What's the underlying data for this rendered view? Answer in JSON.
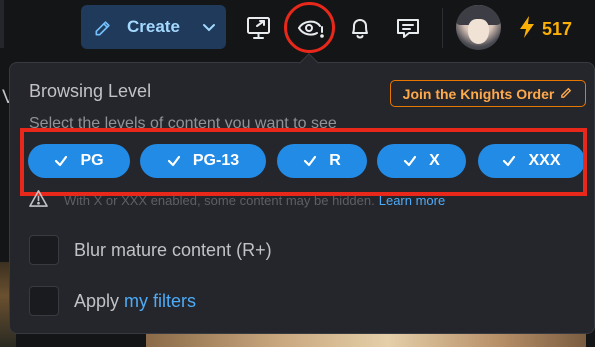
{
  "header": {
    "create_label": "Create",
    "icons": [
      "pencil-icon",
      "chevron-down-icon",
      "screen-share-icon",
      "eye-warning-icon",
      "bell-icon",
      "chat-icon"
    ],
    "buzz_count": "517",
    "accent": "#228be6",
    "highlight": "#e8281a"
  },
  "popover": {
    "title": "Browsing Level",
    "knights_button": "Join the Knights Order",
    "subtitle": "Select the levels of content you want to see",
    "levels": [
      {
        "label": "PG",
        "selected": true
      },
      {
        "label": "PG-13",
        "selected": true
      },
      {
        "label": "R",
        "selected": true
      },
      {
        "label": "X",
        "selected": true
      },
      {
        "label": "XXX",
        "selected": true
      }
    ],
    "warning_text": "With X or XXX enabled, some content may be hidden.",
    "warning_link": "Learn more",
    "blur_label": "Blur mature content (R+)",
    "filters_prefix": "Apply",
    "filters_link": "my filters"
  },
  "background": {
    "letter": "V"
  }
}
